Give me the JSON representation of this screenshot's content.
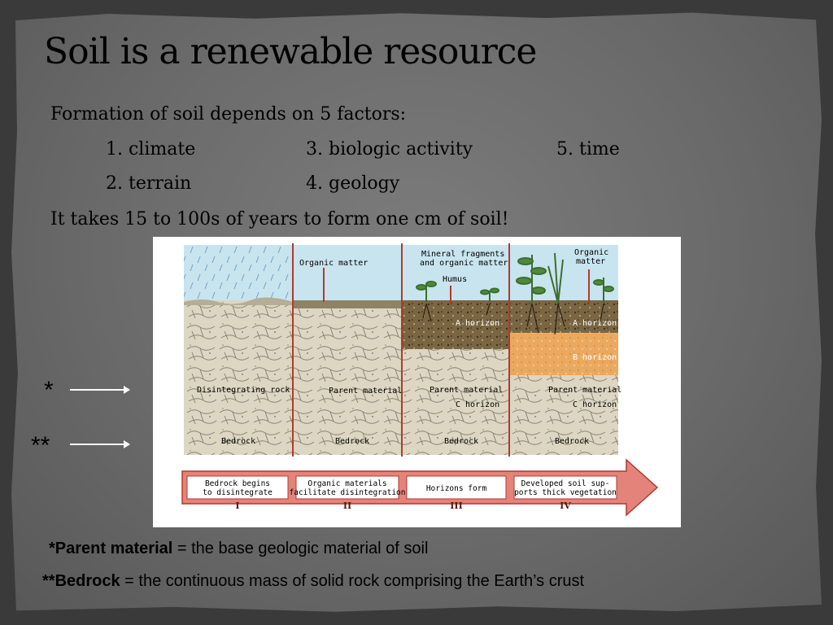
{
  "title": "Soil is a renewable resource",
  "intro": "Formation of soil depends on 5 factors:",
  "factors": {
    "f1": "1.  climate",
    "f2": "2.  terrain",
    "f3": "3.  biologic activity",
    "f4": "4.  geology",
    "f5": "5.  time"
  },
  "time_note": "It takes 15 to 100s of years to form one cm of soil!",
  "markers": {
    "single": "*",
    "double": "**"
  },
  "diagram": {
    "stage1": {
      "labels": [
        "Disintegrating rock",
        "Bedrock"
      ],
      "caption": [
        "Bedrock begins",
        "to disintegrate"
      ],
      "numeral": "I"
    },
    "stage2": {
      "top": "Organic matter",
      "labels": [
        "Parent material",
        "Bedrock"
      ],
      "caption": [
        "Organic materials",
        "facilitate disintegration"
      ],
      "numeral": "II"
    },
    "stage3": {
      "top": [
        "Mineral fragments",
        "and organic matter"
      ],
      "humus": "Humus",
      "a_horizon": "A horizon",
      "labels": [
        "Parent material",
        "C horizon",
        "Bedrock"
      ],
      "caption": [
        "Horizons form"
      ],
      "numeral": "III"
    },
    "stage4": {
      "top": [
        "Organic",
        "matter"
      ],
      "a_horizon": "A horizon",
      "b_horizon": "B horizon",
      "labels": [
        "Parent material",
        "C horizon",
        "Bedrock"
      ],
      "caption": [
        "Developed soil sup-",
        "ports thick vegetation"
      ],
      "numeral": "IV"
    }
  },
  "definitions": {
    "parent_prefix": "*",
    "parent_term": "Parent material",
    "parent_text": " = the base geologic material of soil",
    "bedrock_prefix": "**",
    "bedrock_term": "Bedrock",
    "bedrock_text": " = the continuous mass of solid rock comprising the Earth’s crust"
  },
  "colors": {
    "sky": "#c8e4ef",
    "rock": "#d9d3c0",
    "topsoil": "#6e5a3a",
    "b_horizon": "#eba960",
    "divider": "#b03a2e",
    "arrow_fill": "#e4837a",
    "plant": "#3d6e2f"
  }
}
